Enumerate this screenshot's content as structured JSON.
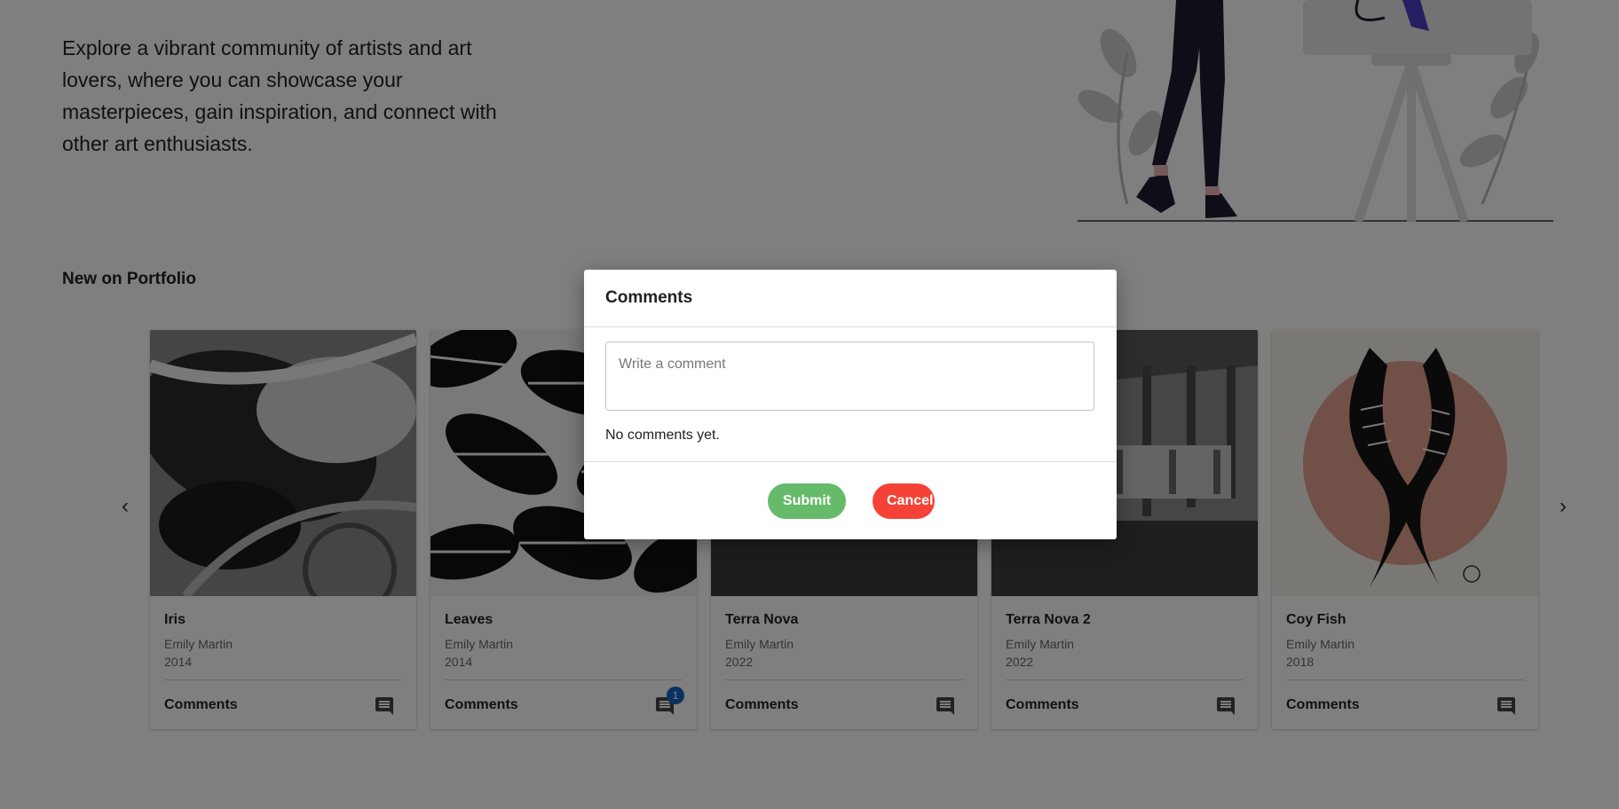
{
  "hero": {
    "description": "Explore a vibrant community of artists and art lovers, where you can showcase your masterpieces, gain inspiration, and connect with other art enthusiasts."
  },
  "section": {
    "title": "New on Portfolio"
  },
  "carousel": {
    "prev_icon": "chevron-left-icon",
    "next_icon": "chevron-right-icon"
  },
  "cards": [
    {
      "title": "Iris",
      "artist": "Emily Martin",
      "year": "2014",
      "comments_label": "Comments",
      "badge": ""
    },
    {
      "title": "Leaves",
      "artist": "Emily Martin",
      "year": "2014",
      "comments_label": "Comments",
      "badge": "1"
    },
    {
      "title": "Terra Nova",
      "artist": "Emily Martin",
      "year": "2022",
      "comments_label": "Comments",
      "badge": ""
    },
    {
      "title": "Terra Nova 2",
      "artist": "Emily Martin",
      "year": "2022",
      "comments_label": "Comments",
      "badge": ""
    },
    {
      "title": "Coy Fish",
      "artist": "Emily Martin",
      "year": "2018",
      "comments_label": "Comments",
      "badge": ""
    }
  ],
  "modal": {
    "title": "Comments",
    "input_placeholder": "Write a comment",
    "empty_text": "No comments yet.",
    "submit_label": "Submit",
    "cancel_label": "Cancel"
  },
  "colors": {
    "submit": "#66bb6a",
    "cancel": "#f44336",
    "badge": "#1565c0",
    "overlay": "rgba(0,0,0,0.5)"
  }
}
